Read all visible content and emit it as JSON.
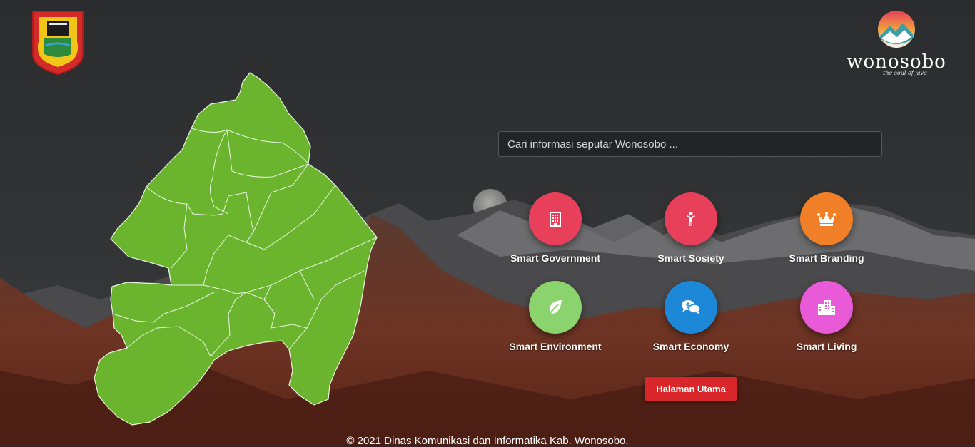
{
  "header": {
    "brand_name": "wonosobo",
    "brand_tagline": "the soul of java"
  },
  "search": {
    "placeholder": "Cari informasi seputar Wonosobo ...",
    "value": ""
  },
  "features": [
    {
      "label": "Smart Government",
      "color": "#e8405a",
      "icon": "building-icon"
    },
    {
      "label": "Smart Sosiety",
      "color": "#e8405a",
      "icon": "person-icon"
    },
    {
      "label": "Smart Branding",
      "color": "#f07f27",
      "icon": "crown-icon"
    },
    {
      "label": "Smart Environment",
      "color": "#8bd36c",
      "icon": "leaf-icon"
    },
    {
      "label": "Smart Economy",
      "color": "#1e88d8",
      "icon": "money-chat-icon"
    },
    {
      "label": "Smart Living",
      "color": "#e85ad8",
      "icon": "city-icon"
    }
  ],
  "home_button": "Halaman Utama",
  "footer": "© 2021 Dinas Komunikasi dan Informatika Kab. Wonosobo.",
  "map": {
    "fill_color": "#6ab42e"
  }
}
